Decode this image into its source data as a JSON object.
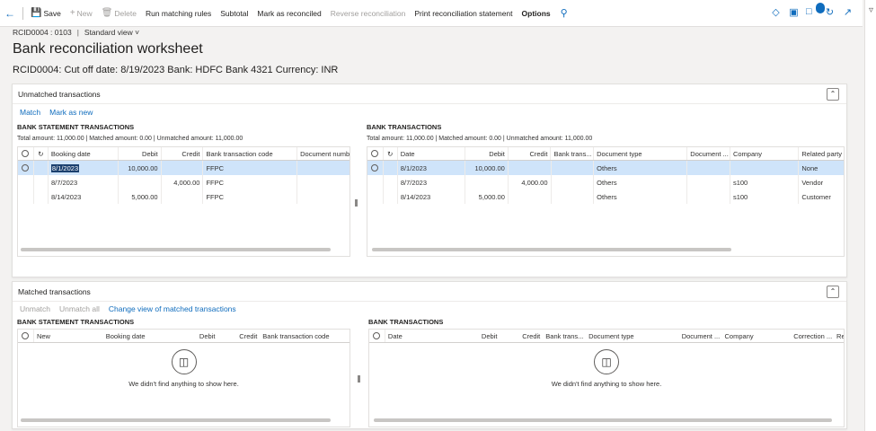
{
  "toolbar": {
    "save": "Save",
    "new": "New",
    "delete": "Delete",
    "run_matching_rules": "Run matching rules",
    "subtotal": "Subtotal",
    "mark_as_reconciled": "Mark as reconciled",
    "reverse_reconciliation": "Reverse reconciliation",
    "print_statement": "Print reconciliation statement",
    "options": "Options",
    "notification_count": "0"
  },
  "breadcrumb": {
    "record": "RCID0004 : 0103",
    "view": "Standard view"
  },
  "page": {
    "title": "Bank reconciliation worksheet",
    "subtitle": "RCID0004: Cut off date: 8/19/2023 Bank: HDFC Bank 4321 Currency: INR"
  },
  "unmatched": {
    "title": "Unmatched transactions",
    "actions": {
      "match": "Match",
      "mark_as_new": "Mark as new"
    },
    "statement": {
      "title": "BANK STATEMENT TRANSACTIONS",
      "totals": "Total amount: 11,000.00 | Matched amount: 0.00 | Unmatched amount: 11,000.00",
      "columns": [
        "Booking date",
        "Debit",
        "Credit",
        "Bank transaction code",
        "Document numb"
      ],
      "rows": [
        [
          "8/1/2023",
          "10,000.00",
          "",
          "FFPC",
          ""
        ],
        [
          "8/7/2023",
          "",
          "4,000.00",
          "FFPC",
          ""
        ],
        [
          "8/14/2023",
          "5,000.00",
          "",
          "FFPC",
          ""
        ]
      ]
    },
    "bank": {
      "title": "BANK TRANSACTIONS",
      "totals": "Total amount: 11,000.00 | Matched amount: 0.00 | Unmatched amount: 11,000.00",
      "columns": [
        "Date",
        "Debit",
        "Credit",
        "Bank trans...",
        "Document type",
        "Document ...",
        "Company",
        "Related party"
      ],
      "rows": [
        [
          "8/1/2023",
          "10,000.00",
          "",
          "",
          "Others",
          "",
          "",
          "None"
        ],
        [
          "8/7/2023",
          "",
          "4,000.00",
          "",
          "Others",
          "",
          "s100",
          "Vendor"
        ],
        [
          "8/14/2023",
          "5,000.00",
          "",
          "",
          "Others",
          "",
          "s100",
          "Customer"
        ]
      ]
    }
  },
  "matched": {
    "title": "Matched transactions",
    "actions": {
      "unmatch": "Unmatch",
      "unmatch_all": "Unmatch all",
      "change_view": "Change view of matched transactions"
    },
    "statement": {
      "title": "BANK STATEMENT TRANSACTIONS",
      "columns": [
        "New",
        "Booking date",
        "Debit",
        "Credit",
        "Bank transaction code"
      ],
      "empty": "We didn't find anything to show here."
    },
    "bank": {
      "title": "BANK TRANSACTIONS",
      "columns": [
        "Date",
        "Debit",
        "Credit",
        "Bank trans...",
        "Document type",
        "Document ...",
        "Company",
        "Correction ...",
        "Re"
      ],
      "empty": "We didn't find anything to show here."
    }
  },
  "colors": {
    "accent": "#0f6cbd",
    "selection": "#cfe4fa"
  }
}
